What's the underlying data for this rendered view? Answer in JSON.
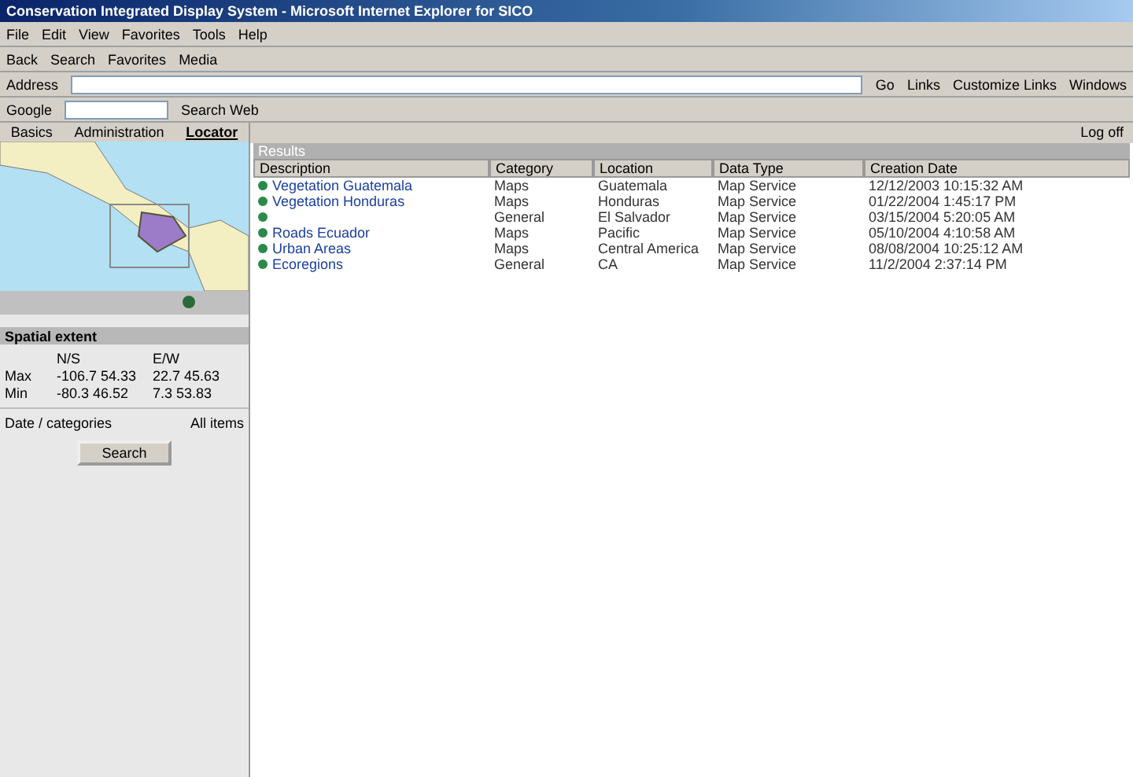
{
  "window": {
    "title": "Conservation Integrated Display System - Microsoft Internet Explorer for SICO"
  },
  "menu": [
    "File",
    "Edit",
    "View",
    "Favorites",
    "Tools",
    "Help"
  ],
  "toolbar": [
    "Back",
    "Search",
    "Favorites",
    "Media"
  ],
  "address": {
    "label": "Address",
    "go": "Go",
    "links": [
      "Links",
      "Customize Links",
      "Windows"
    ]
  },
  "google": {
    "label": "Google",
    "search": "Search Web"
  },
  "left_tabs": [
    {
      "label": "Basics",
      "selected": false
    },
    {
      "label": "Administration",
      "selected": false
    },
    {
      "label": "Locator",
      "selected": true
    }
  ],
  "extent": {
    "title": "Spatial extent",
    "col_1": "N/S",
    "col_2": "E/W",
    "rows": [
      {
        "label": "Max",
        "v1": "-106.7 54.33",
        "v2": "22.7 45.63"
      },
      {
        "label": "Min",
        "v1": "-80.3 46.52",
        "v2": "7.3 53.83"
      }
    ]
  },
  "date": {
    "label": "Date / categories",
    "value": "All items"
  },
  "search_button": "Search",
  "results": {
    "title": "Results",
    "logout": "Log off",
    "columns": [
      "Description",
      "Category",
      "Location",
      "Data Type",
      "Creation Date"
    ],
    "rows": [
      {
        "cells": [
          "Vegetation Guatemala",
          "Maps",
          "Guatemala",
          "Map Service",
          "12/12/2003 10:15:32 AM"
        ]
      },
      {
        "cells": [
          "Vegetation Honduras",
          "Maps",
          "Honduras",
          "Map Service",
          "01/22/2004 1:45:17 PM"
        ]
      },
      {
        "cells": [
          null,
          "General",
          "El Salvador",
          "Map Service",
          "03/15/2004 5:20:05 AM"
        ]
      },
      {
        "cells": [
          "Roads Ecuador",
          "Maps",
          "Pacific",
          "Map Service",
          "05/10/2004 4:10:58 AM"
        ]
      },
      {
        "cells": [
          "Urban Areas",
          "Maps",
          "Central America",
          "Map Service",
          "08/08/2004 10:25:12 AM"
        ]
      },
      {
        "cells": [
          "Ecoregions",
          "General",
          "CA",
          "Map Service",
          "11/2/2004 2:37:14 PM"
        ]
      }
    ]
  }
}
